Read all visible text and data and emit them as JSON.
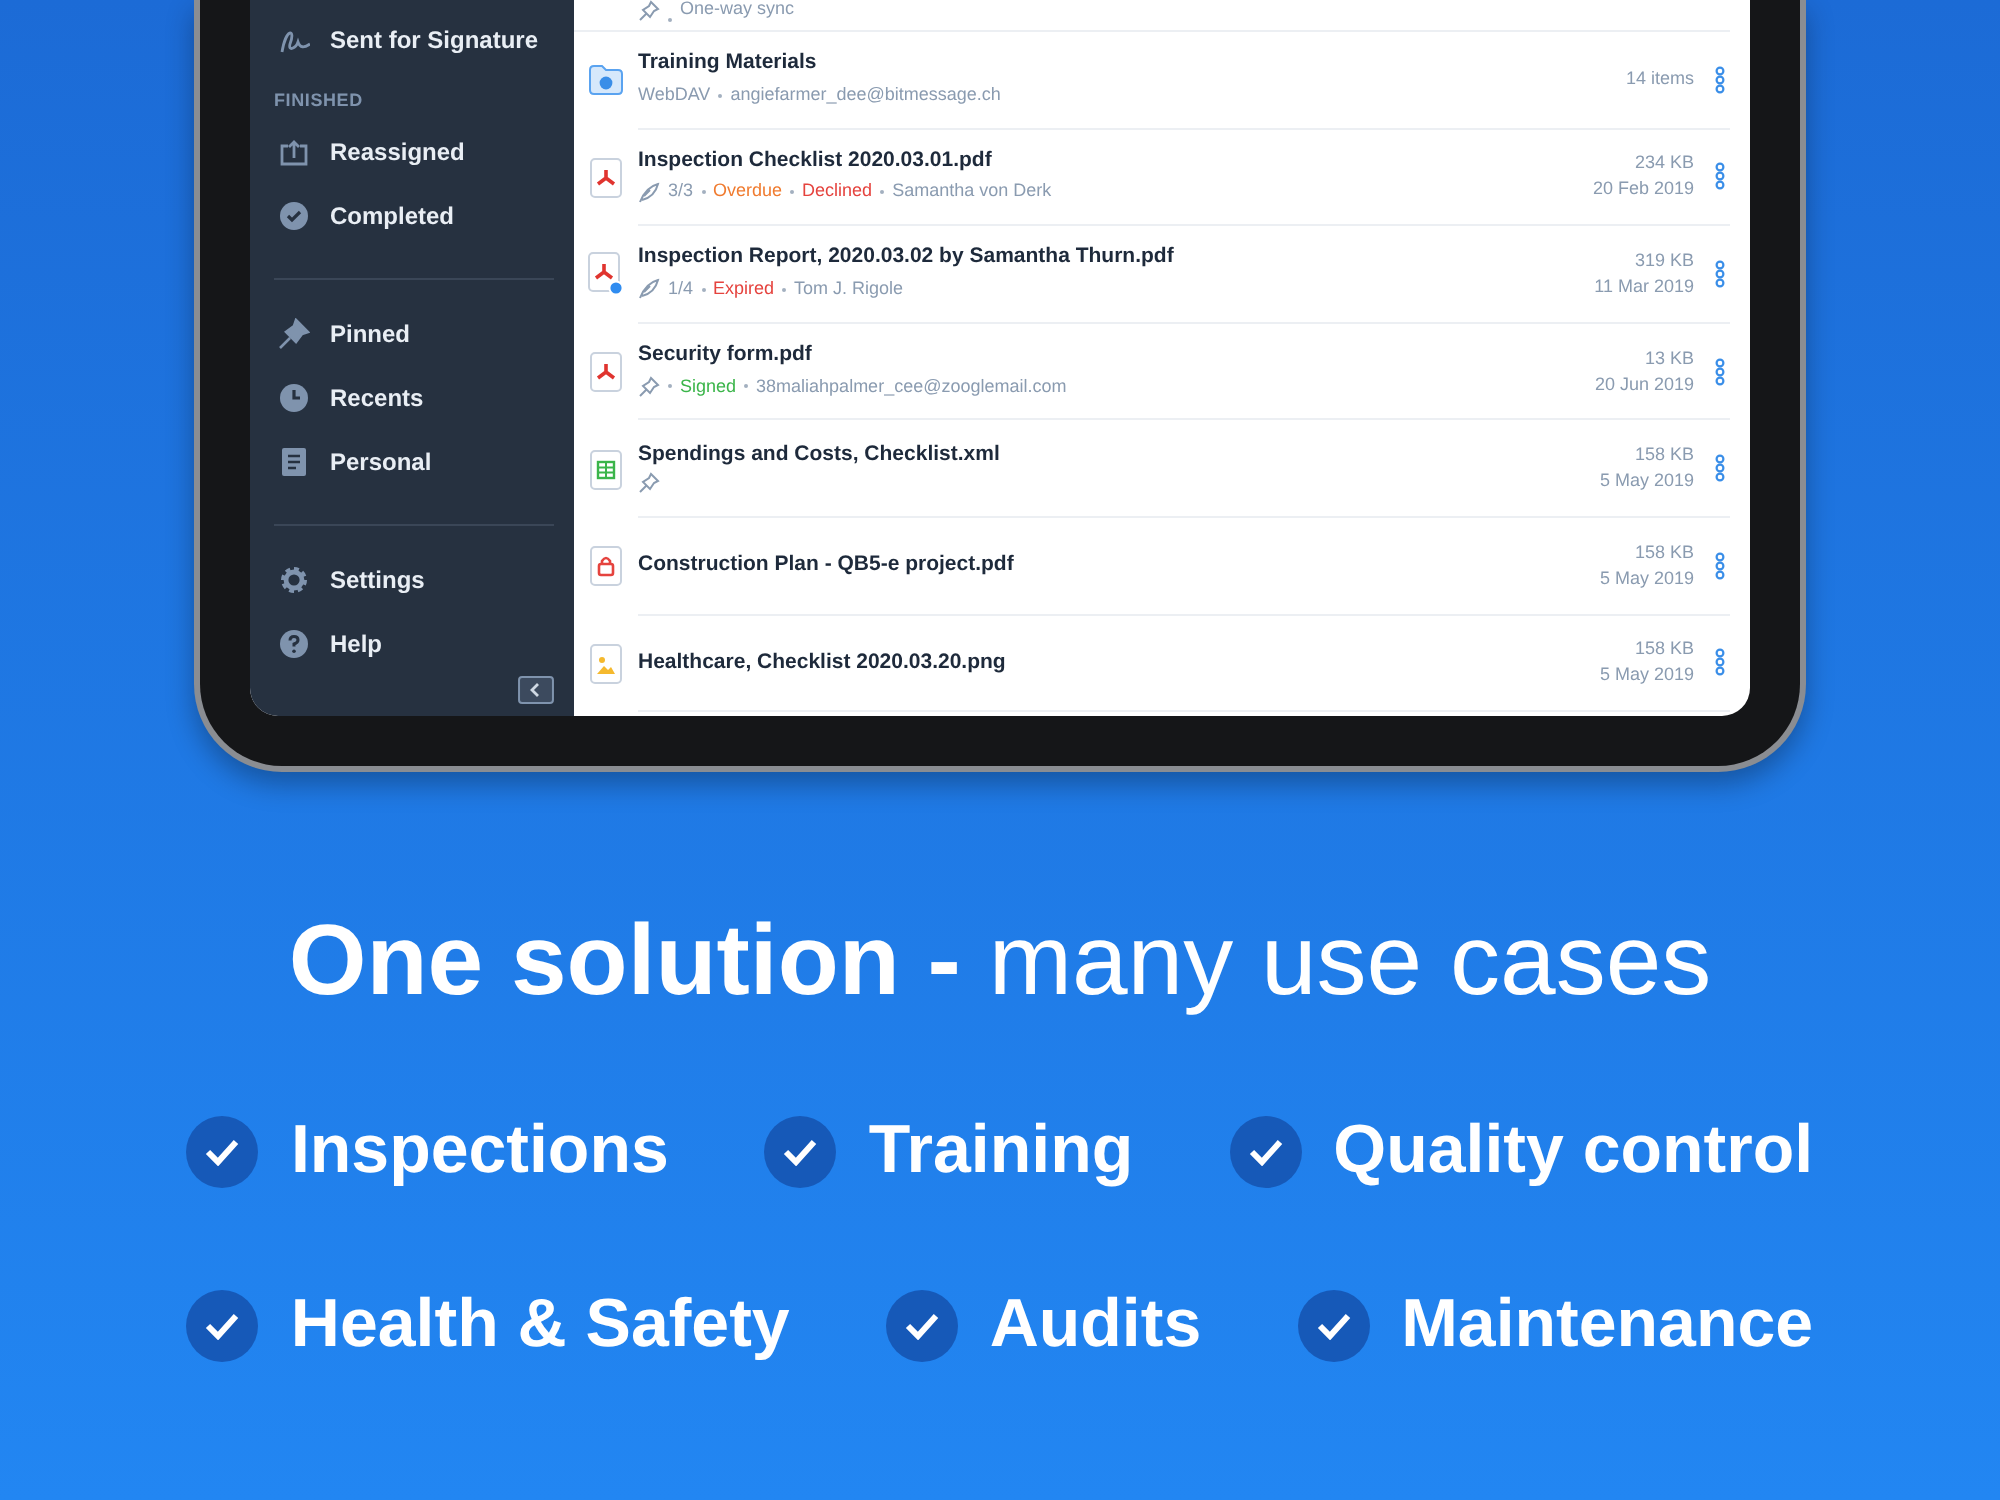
{
  "sidebar": [
    {
      "kind": "item",
      "label": "Sent for Signature"
    },
    {
      "kind": "header",
      "label": "FINISHED"
    },
    {
      "kind": "item",
      "label": "Reassigned"
    },
    {
      "kind": "item",
      "label": "Completed"
    },
    {
      "kind": "divider"
    },
    {
      "kind": "item",
      "label": "Pinned"
    },
    {
      "kind": "item",
      "label": "Recents"
    },
    {
      "kind": "item",
      "label": "Personal"
    },
    {
      "kind": "divider"
    },
    {
      "kind": "item",
      "label": "Settings"
    },
    {
      "kind": "item",
      "label": "Help"
    }
  ],
  "top_row": {
    "meta": [
      {
        "kind": "pin"
      },
      {
        "kind": "text",
        "text": "One-way sync"
      }
    ]
  },
  "files": [
    {
      "name": "Training Materials",
      "meta": [
        {
          "kind": "text",
          "text": "WebDAV"
        },
        {
          "kind": "text",
          "text": "angiefarmer_dee@bitmessage.ch"
        }
      ],
      "size": "14 items"
    },
    {
      "name": "Inspection Checklist 2020.03.01.pdf",
      "meta": [
        {
          "kind": "sign",
          "text": "3/3"
        },
        {
          "kind": "status",
          "text": "Overdue",
          "color": "#f07b2f"
        },
        {
          "kind": "status",
          "text": "Declined",
          "color": "#e5433e"
        },
        {
          "kind": "text",
          "text": "Samantha von Derk"
        }
      ],
      "size": "234 KB",
      "date": "20 Feb 2019"
    },
    {
      "name": "Inspection Report, 2020.03.02 by Samantha Thurn.pdf",
      "meta": [
        {
          "kind": "sign",
          "text": "1/4"
        },
        {
          "kind": "status",
          "text": "Expired",
          "color": "#e5433e"
        },
        {
          "kind": "text",
          "text": "Tom J. Rigole"
        }
      ],
      "size": "319 KB",
      "date": "11 Mar 2019"
    },
    {
      "name": "Security form.pdf",
      "meta": [
        {
          "kind": "pin"
        },
        {
          "kind": "status",
          "text": "Signed",
          "color": "#3bb54a"
        },
        {
          "kind": "text",
          "text": "38maliahpalmer_cee@zooglemail.com"
        }
      ],
      "size": "13 KB",
      "date": "20 Jun 2019"
    },
    {
      "name": "Spendings and Costs, Checklist.xml",
      "meta": [
        {
          "kind": "pin"
        }
      ],
      "size": "158 KB",
      "date": "5 May 2019"
    },
    {
      "name": "Construction Plan - QB5-e project.pdf",
      "size": "158 KB",
      "date": "5 May 2019"
    },
    {
      "name": "Healthcare, Checklist 2020.03.20.png",
      "size": "158 KB",
      "date": "5 May 2019"
    }
  ],
  "headline": "**One solution -** many use cases",
  "feature_rows": [
    {
      "items": [
        "Inspections",
        "Training",
        "Quality control"
      ]
    },
    {
      "items": [
        "Health & Safety",
        "Audits",
        "Maintenance"
      ]
    }
  ]
}
